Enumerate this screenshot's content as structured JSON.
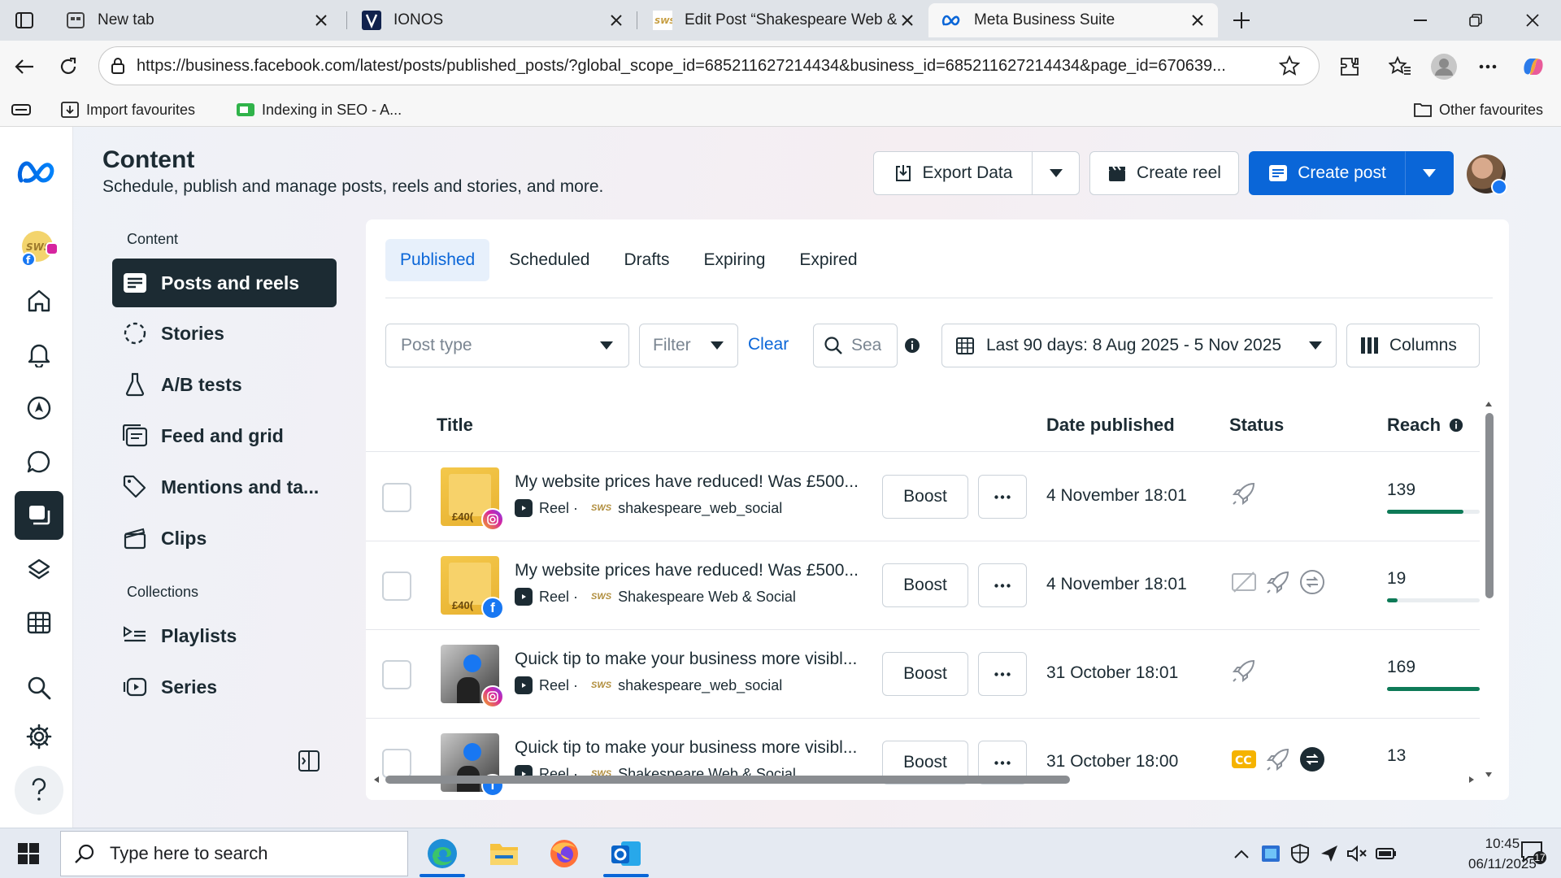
{
  "browser": {
    "tabs": [
      {
        "title": "New tab",
        "icon": "new-tab-icon",
        "active": false
      },
      {
        "title": "IONOS",
        "icon": "ionos-icon",
        "active": false
      },
      {
        "title": "Edit Post “Shakespeare Web & Social”",
        "icon": "sws-icon",
        "active": false
      },
      {
        "title": "Meta Business Suite",
        "icon": "meta-icon",
        "active": true
      }
    ],
    "url": "https://business.facebook.com/latest/posts/published_posts/?global_scope_id=685211627214434&business_id=685211627214434&page_id=670639...",
    "favourites": [
      {
        "label": "Import favourites"
      },
      {
        "label": "Indexing in SEO - A..."
      }
    ],
    "other_favourites": "Other favourites"
  },
  "header": {
    "title": "Content",
    "subtitle": "Schedule, publish and manage posts, reels and stories, and more.",
    "export_label": "Export Data",
    "create_reel_label": "Create reel",
    "create_post_label": "Create post"
  },
  "sidebar": {
    "content_heading": "Content",
    "items": [
      {
        "label": "Posts and reels",
        "active": true
      },
      {
        "label": "Stories"
      },
      {
        "label": "A/B tests"
      },
      {
        "label": "Feed and grid"
      },
      {
        "label": "Mentions and ta..."
      },
      {
        "label": "Clips"
      }
    ],
    "collections_heading": "Collections",
    "collections": [
      {
        "label": "Playlists"
      },
      {
        "label": "Series"
      }
    ]
  },
  "tabs": [
    {
      "label": "Published",
      "active": true
    },
    {
      "label": "Scheduled"
    },
    {
      "label": "Drafts"
    },
    {
      "label": "Expiring"
    },
    {
      "label": "Expired"
    }
  ],
  "filters": {
    "post_type_placeholder": "Post type",
    "filter_label": "Filter",
    "clear_label": "Clear",
    "search_placeholder": "Sea",
    "date_range": "Last 90 days: 8 Aug 2025 - 5 Nov 2025",
    "columns_label": "Columns"
  },
  "table": {
    "columns": [
      "Title",
      "Date published",
      "Status",
      "Reach"
    ],
    "boost_label": "Boost",
    "reach_max": 169,
    "rows": [
      {
        "title": "My website prices have reduced! Was £500...",
        "type": "Reel ·",
        "account": "shakespeare_web_social",
        "platform": "instagram",
        "date": "4 November 18:01",
        "reach": 139,
        "thumb": "yellow",
        "thumb_text": "£40(",
        "status": [
          "boost-rocket-icon"
        ]
      },
      {
        "title": "My website prices have reduced! Was £500...",
        "type": "Reel ·",
        "account": "Shakespeare Web & Social",
        "platform": "facebook",
        "date": "4 November 18:01",
        "reach": 19,
        "thumb": "yellow",
        "thumb_text": "£40(",
        "status": [
          "no-captions-icon",
          "boost-rocket-icon",
          "crossposted-icon"
        ]
      },
      {
        "title": "Quick tip to make your business more visibl...",
        "type": "Reel ·",
        "account": "shakespeare_web_social",
        "platform": "instagram",
        "date": "31 October 18:01",
        "reach": 169,
        "thumb": "photo",
        "thumb_text": "",
        "status": [
          "boost-rocket-icon"
        ]
      },
      {
        "title": "Quick tip to make your business more visibl...",
        "type": "Reel ·",
        "account": "Shakespeare Web & Social",
        "platform": "facebook",
        "date": "31 October 18:00",
        "reach": 13,
        "thumb": "photo",
        "thumb_text": "",
        "status": [
          "captions-icon",
          "boost-rocket-icon",
          "crossposted-dark-icon"
        ]
      }
    ]
  },
  "taskbar": {
    "search_placeholder": "Type here to search",
    "time": "10:45",
    "date": "06/11/2025",
    "notifications": "17"
  },
  "colors": {
    "accent": "#0a66d8",
    "dark": "#1c2b33",
    "reach_bar": "#0e7a57",
    "instagram": "#d6249f",
    "facebook": "#1877f2"
  }
}
